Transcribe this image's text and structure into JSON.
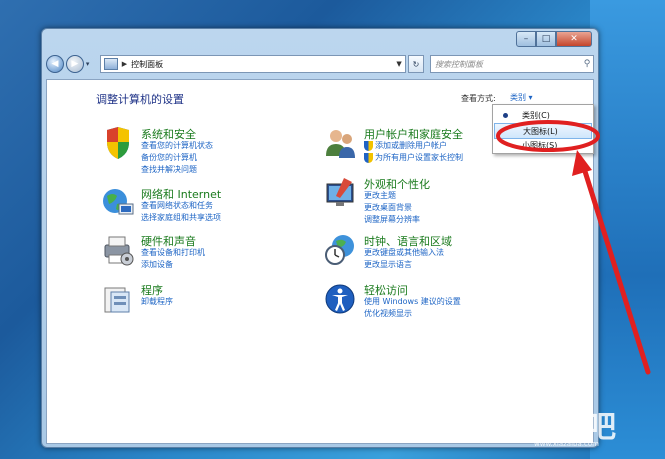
{
  "window": {
    "caption": {
      "minimize": "–",
      "maximize": "□",
      "close": "✕"
    },
    "address": {
      "path": "控制面板"
    },
    "search": {
      "placeholder": "搜索控制面板"
    }
  },
  "page": {
    "title": "调整计算机的设置",
    "view_by_label": "查看方式:",
    "view_by_value": "类别 ▾"
  },
  "categories": {
    "system": {
      "title": "系统和安全",
      "links": [
        "查看您的计算机状态",
        "备份您的计算机",
        "查找并解决问题"
      ]
    },
    "network": {
      "title": "网络和 Internet",
      "links": [
        "查看网络状态和任务",
        "选择家庭组和共享选项"
      ]
    },
    "hardware": {
      "title": "硬件和声音",
      "links": [
        "查看设备和打印机",
        "添加设备"
      ]
    },
    "programs": {
      "title": "程序",
      "links": [
        "卸载程序"
      ]
    },
    "users": {
      "title": "用户帐户和家庭安全",
      "links": [
        "添加或删除用户帐户",
        "为所有用户设置家长控制"
      ]
    },
    "appearance": {
      "title": "外观和个性化",
      "links": [
        "更改主题",
        "更改桌面背景",
        "调整屏幕分辨率"
      ]
    },
    "clock": {
      "title": "时钟、语言和区域",
      "links": [
        "更改键盘或其他输入法",
        "更改显示语言"
      ]
    },
    "ease": {
      "title": "轻松访问",
      "links": [
        "使用 Windows 建议的设置",
        "优化视频显示"
      ]
    }
  },
  "view_menu": {
    "items": [
      {
        "label": "类别(C)",
        "selected": true
      },
      {
        "label": "大图标(L)",
        "selected": false
      },
      {
        "label": "小图标(S)",
        "selected": false
      }
    ]
  },
  "annotation": {
    "color": "#e02020"
  },
  "watermark": {
    "text": "下载吧",
    "sub": "www.xiazaiba.com"
  }
}
